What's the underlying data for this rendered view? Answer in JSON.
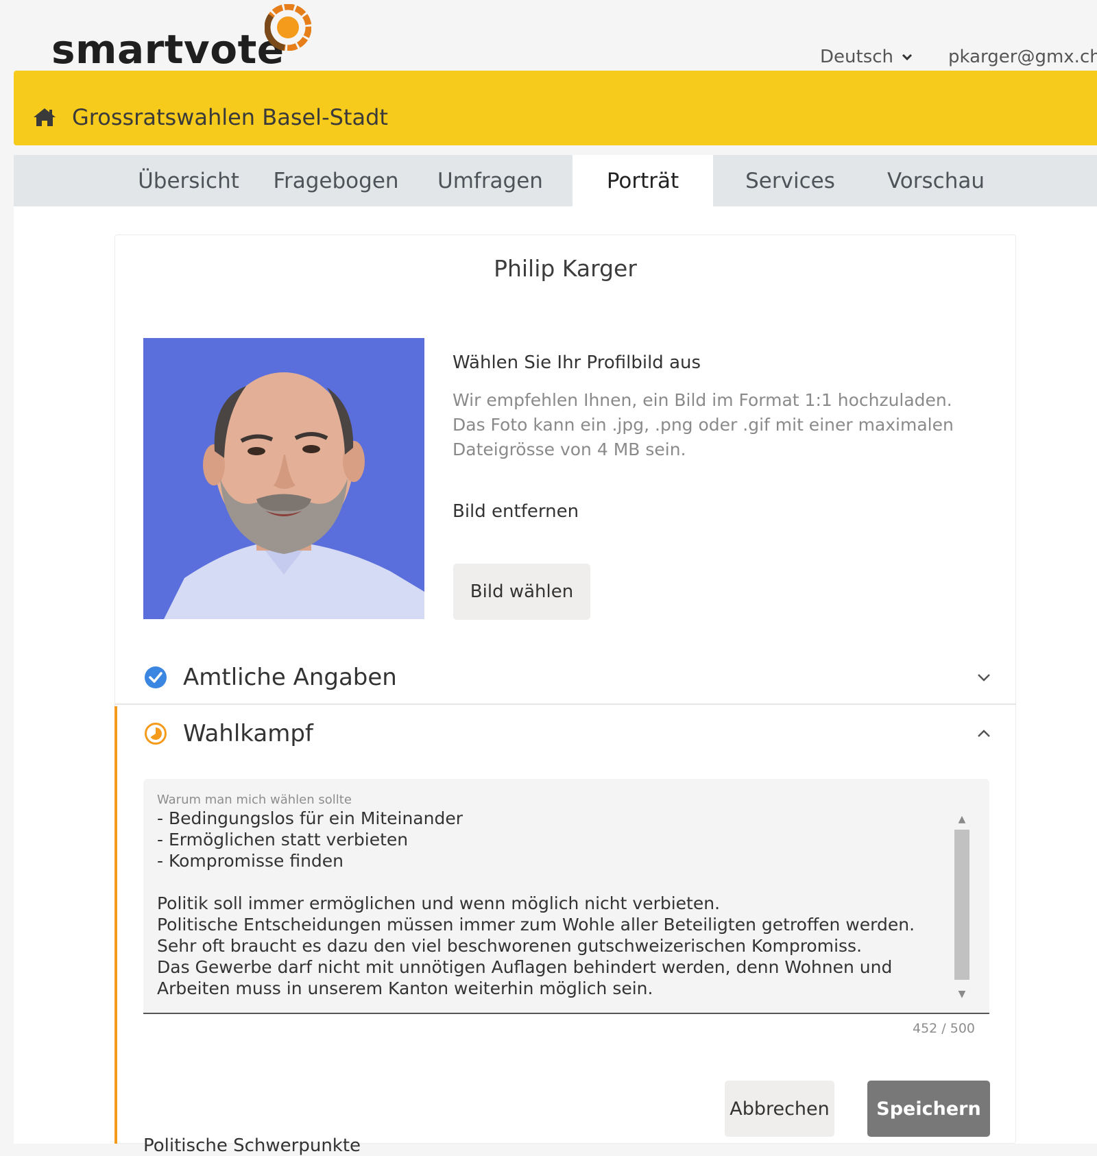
{
  "header": {
    "logo_text": "smartvote",
    "language": "Deutsch",
    "user_email": "pkarger@gmx.ch"
  },
  "banner": {
    "title": "Grossratswahlen Basel-Stadt"
  },
  "tabs": [
    {
      "label": "Übersicht",
      "active": false
    },
    {
      "label": "Fragebogen",
      "active": false
    },
    {
      "label": "Umfragen",
      "active": false
    },
    {
      "label": "Porträt",
      "active": true
    },
    {
      "label": "Services",
      "active": false
    },
    {
      "label": "Vorschau",
      "active": false
    }
  ],
  "profile": {
    "name": "Philip Karger",
    "picture_title": "Wählen Sie Ihr Profilbild aus",
    "picture_help": "Wir empfehlen Ihnen, ein Bild im Format 1:1 hochzuladen. Das Foto kann ein .jpg, .png oder .gif mit einer maximalen Dateigrösse von 4 MB sein.",
    "remove_label": "Bild entfernen",
    "choose_label": "Bild wählen"
  },
  "sections": {
    "official": {
      "title": "Amtliche Angaben",
      "status": "complete"
    },
    "campaign": {
      "title": "Wahlkampf",
      "status": "in-progress"
    }
  },
  "campaign_form": {
    "field_label": "Warum man mich wählen sollte",
    "field_value": "- Bedingungslos für ein Miteinander\n- Ermöglichen statt verbieten\n- Kompromisse finden\n\nPolitik soll immer ermöglichen und wenn möglich nicht verbieten.\nPolitische Entscheidungen müssen immer zum Wohle aller Beteiligten getroffen werden. Sehr oft braucht es dazu den viel beschworenen gutschweizerischen Kompromiss.\nDas Gewerbe darf nicht mit unnötigen Auflagen behindert werden, denn Wohnen und Arbeiten muss in unserem Kanton weiterhin möglich sein.",
    "char_count": "452 / 500",
    "cancel_label": "Abbrechen",
    "save_label": "Speichern",
    "next_field_label": "Politische Schwerpunkte"
  },
  "colors": {
    "banner": "#f7cb1b",
    "accent_orange": "#f59b1b",
    "check_blue": "#3a86e0"
  }
}
